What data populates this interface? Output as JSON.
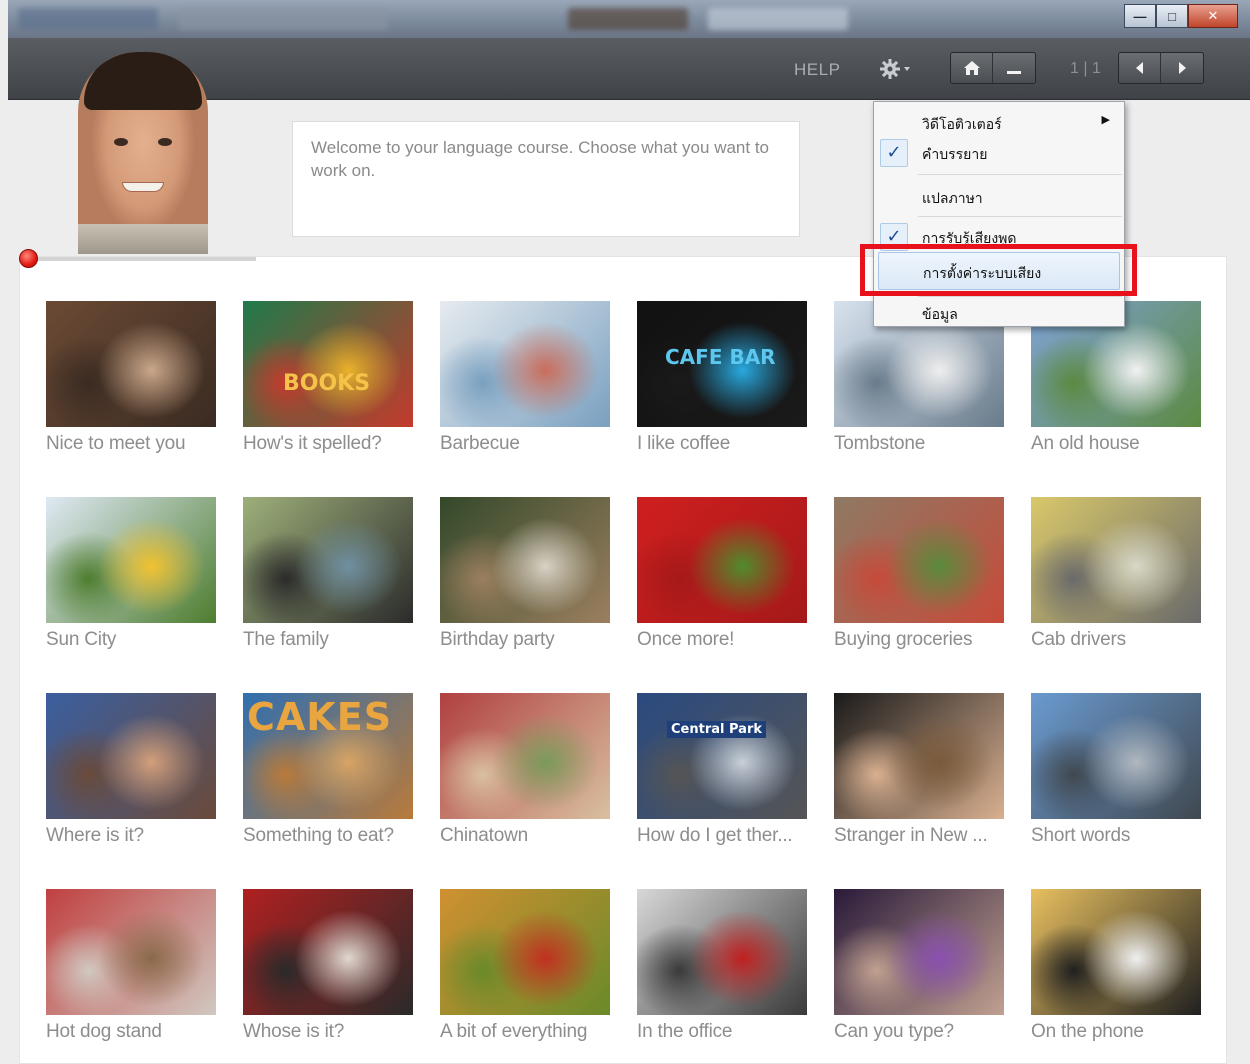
{
  "toolbar": {
    "help_label": "HELP",
    "pager": "1 | 1"
  },
  "welcome": {
    "text": "Welcome to your language course. Choose what you want to work on."
  },
  "lessons": [
    {
      "label": "Nice to meet you",
      "colors": [
        "#6b4a34",
        "#c9a78a",
        "#3a2b22"
      ]
    },
    {
      "label": "How's it spelled?",
      "colors": [
        "#1f7a4a",
        "#e9b12a",
        "#c43a2c"
      ],
      "sign": "BOOKS"
    },
    {
      "label": "Barbecue",
      "colors": [
        "#e6ebef",
        "#c96d5c",
        "#7aa0c0"
      ]
    },
    {
      "label": "I like coffee",
      "colors": [
        "#111111",
        "#29a9df",
        "#1a1a1a"
      ],
      "sign": "CAFE BAR"
    },
    {
      "label": "Tombstone",
      "colors": [
        "#d7e2ee",
        "#eeeeee",
        "#6a7c8c"
      ]
    },
    {
      "label": "An old house",
      "colors": [
        "#7fa3d6",
        "#f2f2f2",
        "#5c8a42"
      ]
    },
    {
      "label": "Sun City",
      "colors": [
        "#dfe9f4",
        "#f0c230",
        "#4e7d2f"
      ]
    },
    {
      "label": "The family",
      "colors": [
        "#9eb07a",
        "#6f8fa0",
        "#2b2b2b"
      ]
    },
    {
      "label": "Birthday party",
      "colors": [
        "#33492a",
        "#d9d2c5",
        "#9b7f5f"
      ]
    },
    {
      "label": "Once more!",
      "colors": [
        "#cf1f1f",
        "#4f8c2c",
        "#a51919"
      ]
    },
    {
      "label": "Buying groceries",
      "colors": [
        "#8e7a64",
        "#5a8a3a",
        "#c74a3a"
      ]
    },
    {
      "label": "Cab drivers",
      "colors": [
        "#d9c86a",
        "#d8d8c8",
        "#6a6a6a"
      ]
    },
    {
      "label": "Where is it?",
      "colors": [
        "#3b5fa0",
        "#d39f7a",
        "#6a4a3a"
      ]
    },
    {
      "label": "Something to eat?",
      "colors": [
        "#2f6fb0",
        "#d8a464",
        "#b97a3a"
      ],
      "sign": "CAKES"
    },
    {
      "label": "Chinatown",
      "colors": [
        "#b04040",
        "#7a9a5a",
        "#d9c0a0"
      ]
    },
    {
      "label": "How do I get ther...",
      "colors": [
        "#2a4a80",
        "#c8d0d8",
        "#555555"
      ],
      "sign": "Central Park"
    },
    {
      "label": "Stranger in New ...",
      "colors": [
        "#1a1a1a",
        "#7a5a3a",
        "#d9b090"
      ]
    },
    {
      "label": "Short words",
      "colors": [
        "#6a9ad0",
        "#b0b8c0",
        "#404850"
      ]
    },
    {
      "label": "Hot dog stand",
      "colors": [
        "#c04040",
        "#8a6a4a",
        "#d0c8c0"
      ]
    },
    {
      "label": "Whose is it?",
      "colors": [
        "#b02020",
        "#e0d8d0",
        "#2a2a2a"
      ]
    },
    {
      "label": "A bit of everything",
      "colors": [
        "#d09030",
        "#c03020",
        "#6a8a2a"
      ]
    },
    {
      "label": "In the office",
      "colors": [
        "#d8d8d8",
        "#c02020",
        "#3a3a3a"
      ]
    },
    {
      "label": "Can you type?",
      "colors": [
        "#2a1a3a",
        "#8a50b0",
        "#c0a090"
      ]
    },
    {
      "label": "On the phone",
      "colors": [
        "#e8c060",
        "#f0f0f0",
        "#202020"
      ]
    }
  ],
  "menu": {
    "items": [
      {
        "label": "วิดีโอติวเตอร์",
        "checked": false,
        "submenu": true
      },
      {
        "label": "คำบรรยาย",
        "checked": true,
        "submenu": false
      },
      {
        "label": "แปลภาษา",
        "checked": false,
        "submenu": false
      },
      {
        "label": "การรับรู้เสียงพูด",
        "checked": true,
        "submenu": false
      },
      {
        "label": "การตั้งค่าระบบเสียง",
        "checked": false,
        "submenu": false,
        "hover": true
      },
      {
        "label": "ข้อมูล",
        "checked": false,
        "submenu": false
      }
    ]
  },
  "colors": {
    "accent_highlight": "#e8121d",
    "progress_red": "#e21a12",
    "toolbar_bg": "#4a4e52"
  }
}
